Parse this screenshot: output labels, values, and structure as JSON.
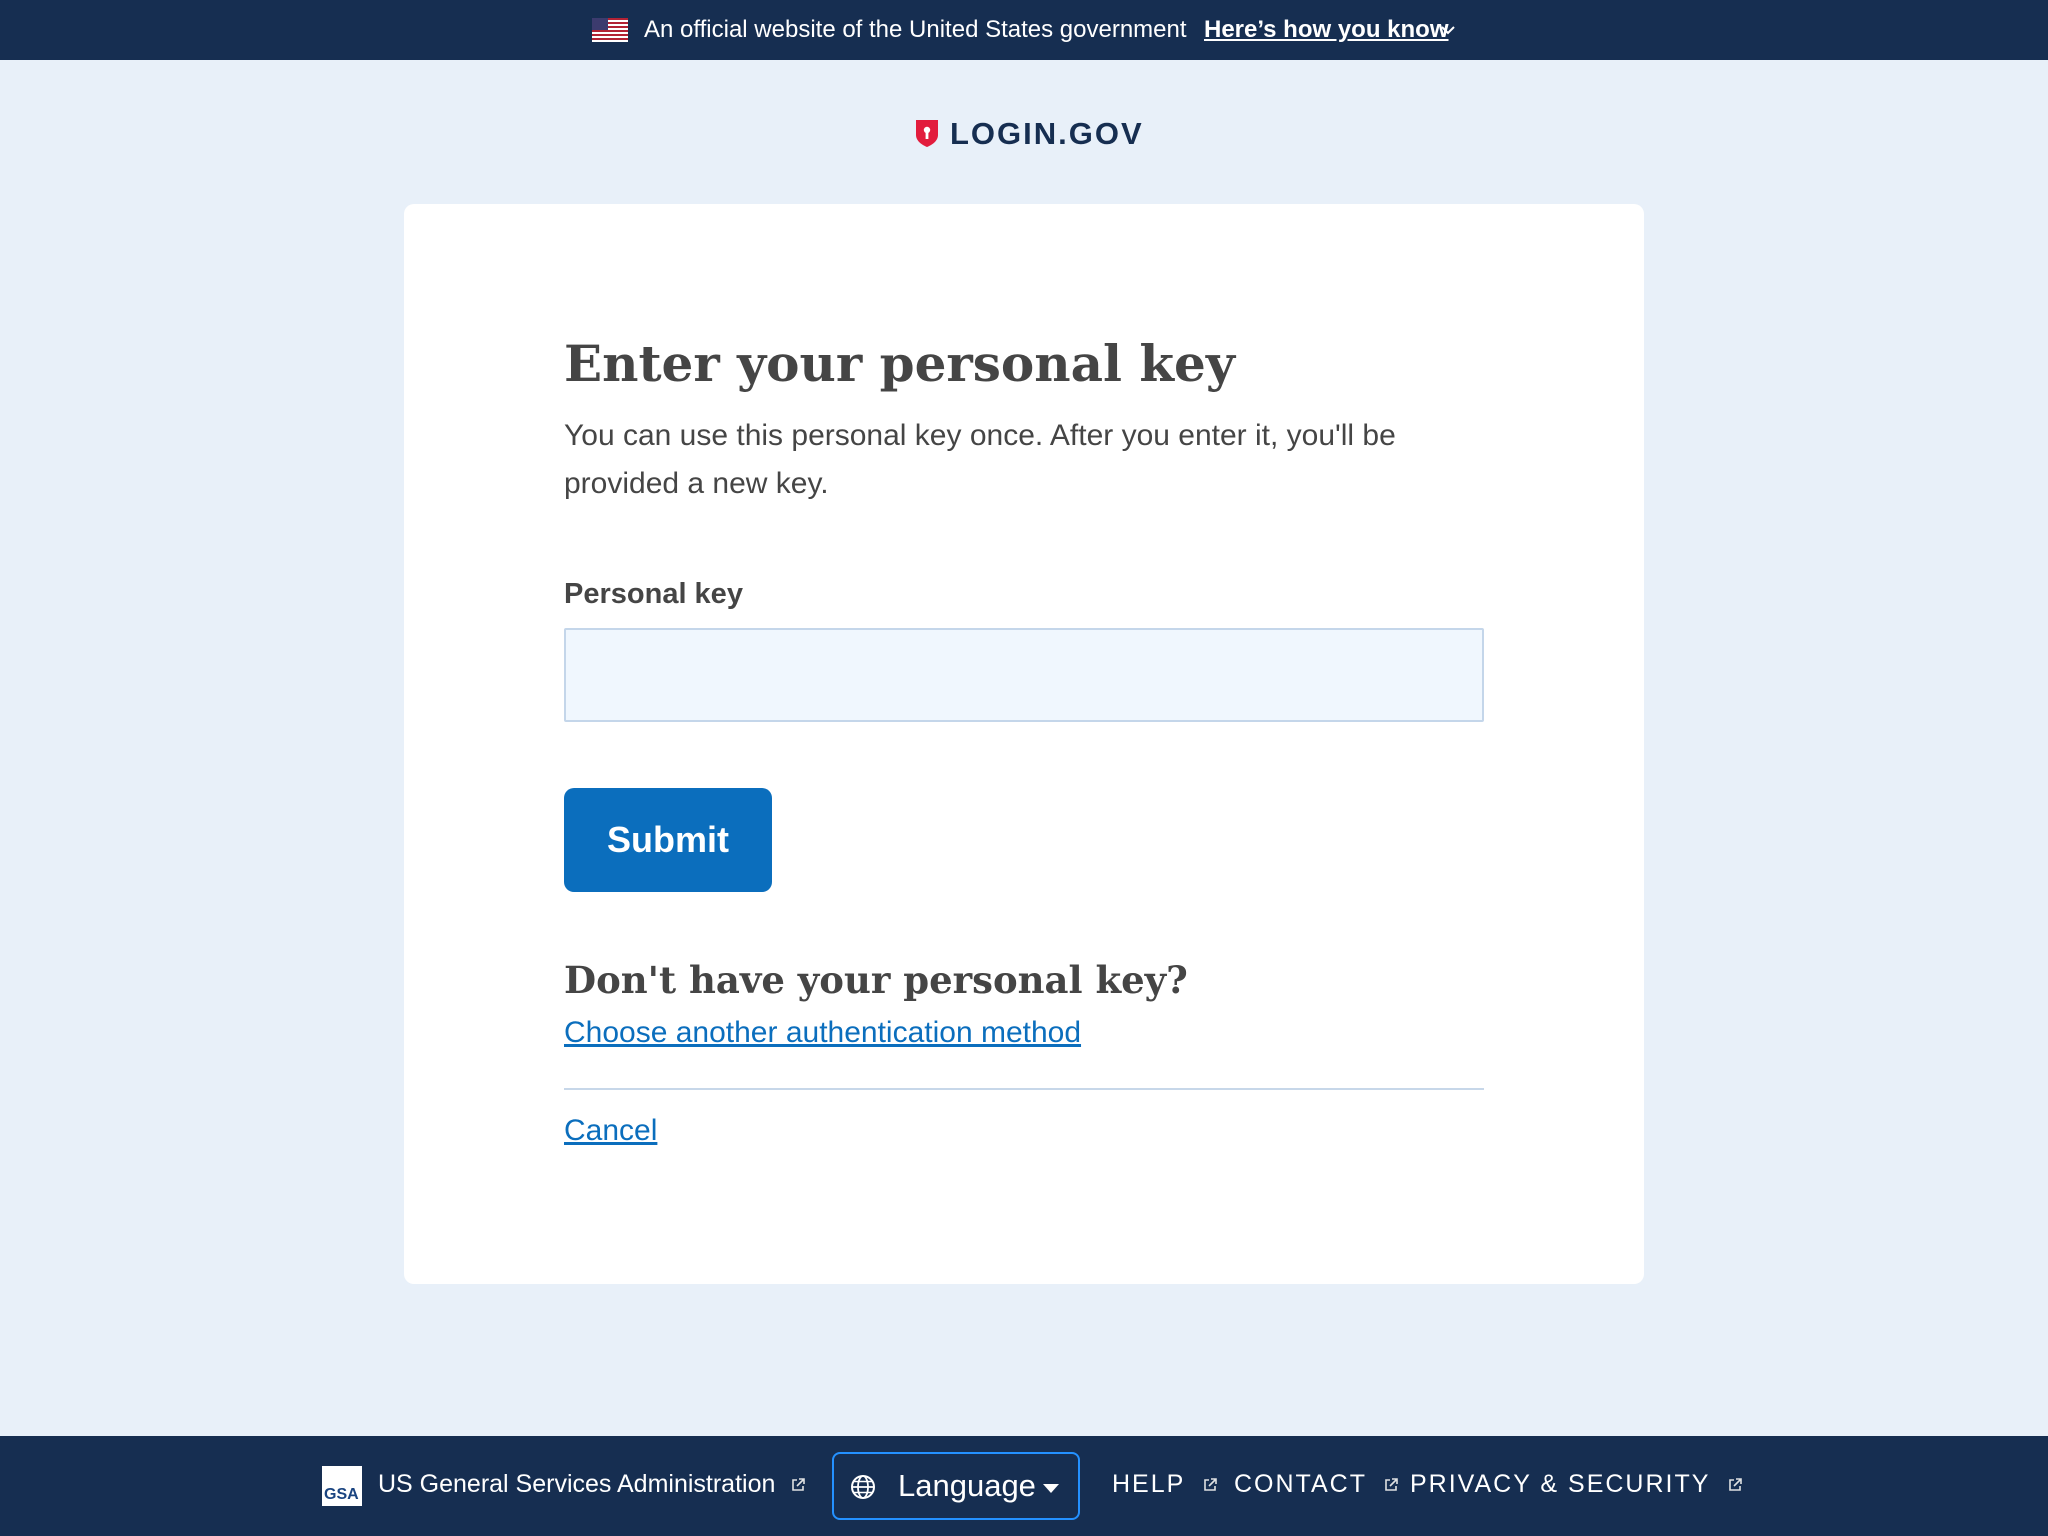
{
  "gov_banner": {
    "official_text": "An official website of the United States government",
    "how_you_know_label": "Here’s how you know"
  },
  "logo": {
    "text": "LOGIN.GOV"
  },
  "main": {
    "title": "Enter your personal key",
    "intro": "You can use this personal key once. After you enter it, you'll be provided a new key.",
    "field_label": "Personal key",
    "field_value": "",
    "submit_label": "Submit",
    "subheading": "Don't have your personal key?",
    "alt_method_link": "Choose another authentication method",
    "cancel_link": "Cancel"
  },
  "footer": {
    "gsa_logo_text": "GSA",
    "agency_link": "US General Services Administration",
    "language_label": "Language",
    "nav": [
      {
        "label": "HELP"
      },
      {
        "label": "CONTACT"
      },
      {
        "label": "PRIVACY & SECURITY"
      }
    ]
  },
  "icons": {
    "flag": "us-flag-icon",
    "chevron": "chevron-down-icon",
    "shield": "shield-lock-icon",
    "external": "external-link-icon",
    "globe": "globe-icon",
    "caret": "caret-down-icon"
  },
  "colors": {
    "banner_bg": "#162e51",
    "page_bg": "#e8f0f9",
    "primary": "#0b6ebd",
    "link": "#0b6ebd",
    "input_bg": "#f0f7fe",
    "logo_red": "#e21c3d",
    "language_border": "#2491ff"
  }
}
